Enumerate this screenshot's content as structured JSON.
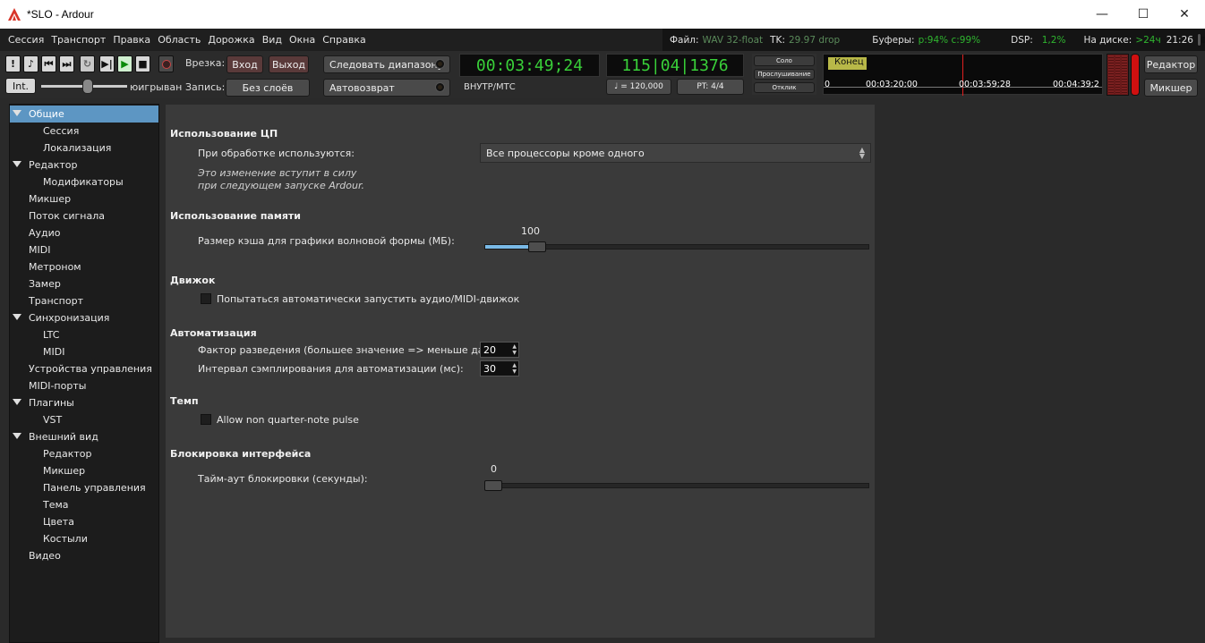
{
  "window": {
    "title": "*SLO - Ardour",
    "minimize": "—",
    "maximize": "☐",
    "close": "✕"
  },
  "menu": [
    "Сессия",
    "Транспорт",
    "Правка",
    "Область",
    "Дорожка",
    "Вид",
    "Окна",
    "Справка"
  ],
  "status": {
    "file_label": "Файл:",
    "file_value": "WAV 32-float",
    "tc_label": "TK:",
    "tc_value": "29.97 drop",
    "buffers_label": "Буферы:",
    "buffers_value": "p:94% c:99%",
    "dsp_label": "DSP:",
    "dsp_value": "1,2%",
    "disk_label": "На диске:",
    "disk_value": ">24ч",
    "time": "21:26"
  },
  "toolbar": {
    "punch_label": "Врезка:",
    "in_button": "Вход",
    "out_button": "Выход",
    "follow_range": "Следовать диапазону",
    "record_label": "Запись:",
    "no_layers": "Без слоёв",
    "auto_return": "Автовозврат",
    "int_button": "Int.",
    "shuttle_label": "юигрыван",
    "primary_clock": "00:03:49;24",
    "clock_source": "ВНУТР/МТС",
    "secondary_clock": "115|04|1376",
    "tempo": "♩ = 120,000",
    "meter": "PT: 4/4",
    "solo": "Соло",
    "audition": "Прослушивание",
    "feedback": "Отклик",
    "end_marker": "Конец",
    "ruler_ticks": [
      "0",
      "00:03:20;00",
      "00:03:59;28",
      "00:04:39;2"
    ],
    "editor_button": "Редактор",
    "mixer_button": "Микшер"
  },
  "sidebar": [
    {
      "label": "Общие",
      "level": 0,
      "expanded": true,
      "selected": true
    },
    {
      "label": "Сессия",
      "level": 1
    },
    {
      "label": "Локализация",
      "level": 1
    },
    {
      "label": "Редактор",
      "level": 0,
      "expanded": true
    },
    {
      "label": "Модификаторы",
      "level": 1
    },
    {
      "label": "Микшер",
      "level": 0
    },
    {
      "label": "Поток сигнала",
      "level": 0
    },
    {
      "label": "Аудио",
      "level": 0
    },
    {
      "label": "MIDI",
      "level": 0
    },
    {
      "label": "Метроном",
      "level": 0
    },
    {
      "label": "Замер",
      "level": 0
    },
    {
      "label": "Транспорт",
      "level": 0
    },
    {
      "label": "Синхронизация",
      "level": 0,
      "expanded": true
    },
    {
      "label": "LTC",
      "level": 1
    },
    {
      "label": "MIDI",
      "level": 1
    },
    {
      "label": "Устройства управления",
      "level": 0
    },
    {
      "label": "MIDI-порты",
      "level": 0
    },
    {
      "label": "Плагины",
      "level": 0,
      "expanded": true
    },
    {
      "label": "VST",
      "level": 1
    },
    {
      "label": "Внешний вид",
      "level": 0,
      "expanded": true
    },
    {
      "label": "Редактор",
      "level": 1
    },
    {
      "label": "Микшер",
      "level": 1
    },
    {
      "label": "Панель управления",
      "level": 1
    },
    {
      "label": "Тема",
      "level": 1
    },
    {
      "label": "Цвета",
      "level": 1
    },
    {
      "label": "Костыли",
      "level": 1
    },
    {
      "label": "Видео",
      "level": 0
    }
  ],
  "settings": {
    "cpu": {
      "title": "Использование ЦП",
      "processors_label": "При обработке используются:",
      "processors_value": "Все процессоры кроме одного",
      "note_line1": "Это изменение вступит в силу",
      "note_line2": "при следующем запуске Ardour."
    },
    "memory": {
      "title": "Использование памяти",
      "cache_label": "Размер кэша для графики волновой формы (МБ):",
      "cache_value": "100",
      "cache_fraction": 0.12
    },
    "engine": {
      "title": "Движок",
      "autostart_label": "Попытаться автоматически запустить аудио/MIDI-движок",
      "autostart_checked": false
    },
    "automation": {
      "title": "Автоматизация",
      "thinning_label": "Фактор разведения (большее значение => меньше данных):",
      "thinning_value": "20",
      "interval_label": "Интервал сэмплирования для автоматизации (мс):",
      "interval_value": "30"
    },
    "tempo": {
      "title": "Темп",
      "pulse_label": "Allow non quarter-note pulse",
      "pulse_checked": false
    },
    "lock": {
      "title": "Блокировка интерфейса",
      "timeout_label": "Тайм-аут блокировки (секунды):",
      "timeout_value": "0",
      "timeout_fraction": 0.0
    }
  }
}
